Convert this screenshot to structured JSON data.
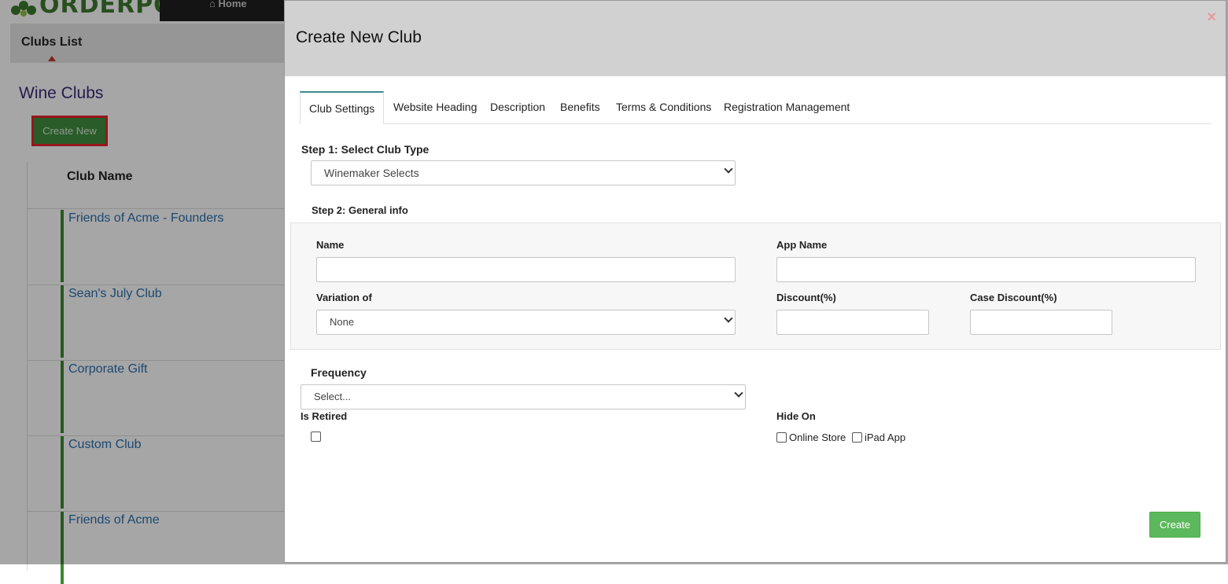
{
  "app": {
    "logo_text": "ORDERPORT",
    "nav_home_label": "Home"
  },
  "background": {
    "subnav_title": "Clubs List",
    "page_title": "Wine Clubs",
    "create_new_label": "Create New",
    "table_header": "Club Name",
    "clubs": [
      "Friends of Acme - Founders",
      "Sean's July Club",
      "Corporate Gift",
      "Custom Club",
      "Friends of Acme"
    ]
  },
  "modal": {
    "title": "Create New Club",
    "close_glyph": "×",
    "tabs": [
      "Club Settings",
      "Website Heading",
      "Description",
      "Benefits",
      "Terms & Conditions",
      "Registration Management"
    ],
    "active_tab": "Club Settings",
    "step1_label": "Step 1: Select Club Type",
    "club_type_value": "Winemaker Selects",
    "step2_label": "Step 2: General info",
    "name_label": "Name",
    "name_value": "",
    "app_name_label": "App Name",
    "app_name_value": "",
    "variation_label": "Variation of",
    "variation_value": "None",
    "discount_label": "Discount(%)",
    "discount_value": "",
    "case_discount_label": "Case Discount(%)",
    "case_discount_value": "",
    "frequency_label": "Frequency",
    "frequency_value": "Select...",
    "is_retired_label": "Is Retired",
    "is_retired_checked": false,
    "hide_on_label": "Hide On",
    "hide_on_options": [
      {
        "label": "Online Store",
        "checked": false
      },
      {
        "label": "iPad App",
        "checked": false
      }
    ],
    "create_button_label": "Create"
  },
  "colors": {
    "primary_green": "#5cb85c",
    "bg_green_button": "#3f8e3f",
    "highlight_red": "#e8222a",
    "link_blue": "#2c6fae",
    "title_purple": "#3c2a7a"
  }
}
